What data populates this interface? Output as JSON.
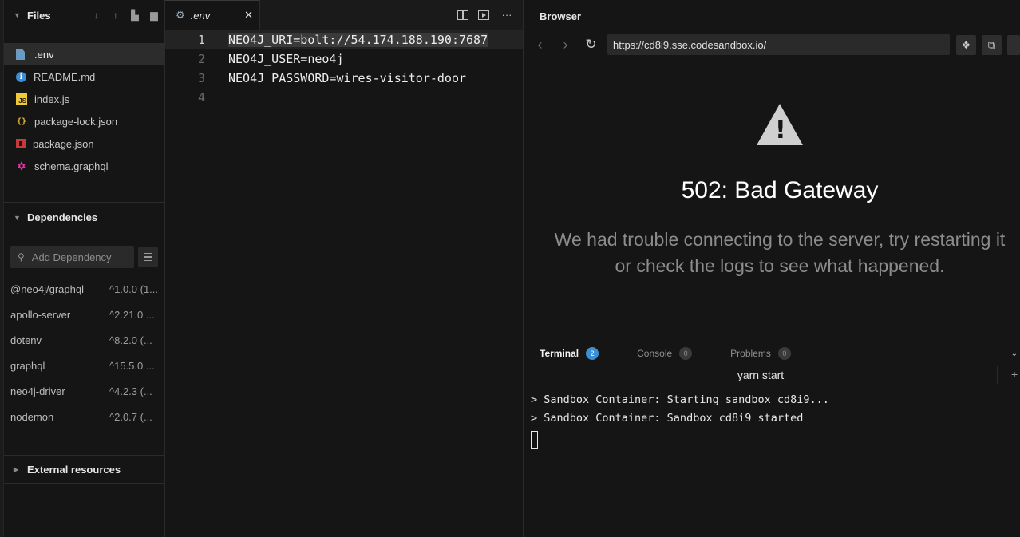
{
  "explorer": {
    "files_title": "Files",
    "files": [
      {
        "name": ".env",
        "icon": "env-file-icon",
        "active": true
      },
      {
        "name": "README.md",
        "icon": "info-icon"
      },
      {
        "name": "index.js",
        "icon": "js-file-icon"
      },
      {
        "name": "package-lock.json",
        "icon": "json-file-icon"
      },
      {
        "name": "package.json",
        "icon": "npm-icon"
      },
      {
        "name": "schema.graphql",
        "icon": "graphql-icon"
      }
    ],
    "dependencies_title": "Dependencies",
    "add_dependency_placeholder": "Add Dependency",
    "dependencies": [
      {
        "name": "@neo4j/graphql",
        "version": "^1.0.0 (1..."
      },
      {
        "name": "apollo-server",
        "version": "^2.21.0 ..."
      },
      {
        "name": "dotenv",
        "version": "^8.2.0 (..."
      },
      {
        "name": "graphql",
        "version": "^15.5.0 ..."
      },
      {
        "name": "neo4j-driver",
        "version": "^4.2.3 (..."
      },
      {
        "name": "nodemon",
        "version": "^2.0.7 (..."
      }
    ],
    "external_title": "External resources"
  },
  "editor": {
    "tab_label": ".env",
    "lines": [
      {
        "number": "1",
        "text": "NEO4J_URI=bolt://54.174.188.190:7687"
      },
      {
        "number": "2",
        "text": "NEO4J_USER=neo4j"
      },
      {
        "number": "3",
        "text": "NEO4J_PASSWORD=wires-visitor-door"
      },
      {
        "number": "4",
        "text": ""
      }
    ]
  },
  "browser": {
    "title": "Browser",
    "url": "https://cd8i9.sse.codesandbox.io/",
    "error_title": "502: Bad Gateway",
    "error_line1": "We had trouble connecting to the server, try restarting it",
    "error_line2": "or check the logs to see what happened."
  },
  "terminal": {
    "tabs": [
      {
        "label": "Terminal",
        "count": "2"
      },
      {
        "label": "Console",
        "count": "0"
      },
      {
        "label": "Problems",
        "count": "0"
      }
    ],
    "process": "yarn start",
    "output": [
      "> Sandbox Container: Starting sandbox cd8i9...",
      "> Sandbox Container: Sandbox cd8i9 started"
    ]
  }
}
